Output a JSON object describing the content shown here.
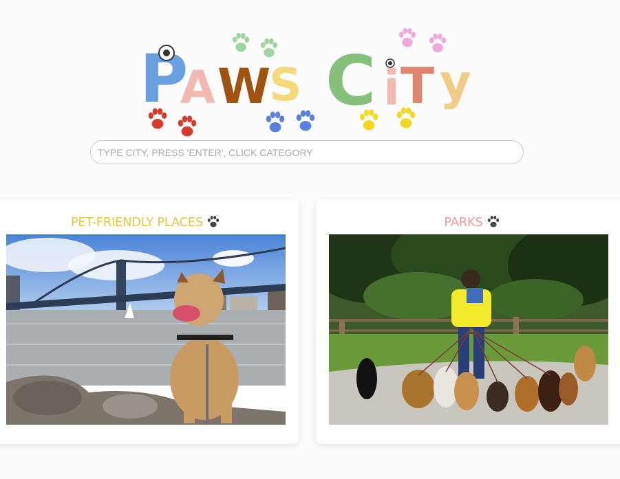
{
  "logo": {
    "text": "PAWS CITY",
    "colors": [
      "#6a9fe0",
      "#f2b8b2",
      "#a0520f",
      "#f5da7d",
      "#86c07a",
      "#f2b8b2",
      "#e0866f",
      "#f0cd86"
    ]
  },
  "search": {
    "placeholder": "TYPE CITY, PRESS 'ENTER', CLICK CATEGORY",
    "value": ""
  },
  "categories": [
    {
      "title": "PET-FRIENDLY PLACES",
      "title_color": "#e2c842",
      "icon": "paw-icon"
    },
    {
      "title": "PARKS",
      "title_color": "#e89c9c",
      "icon": "paw-icon"
    }
  ]
}
